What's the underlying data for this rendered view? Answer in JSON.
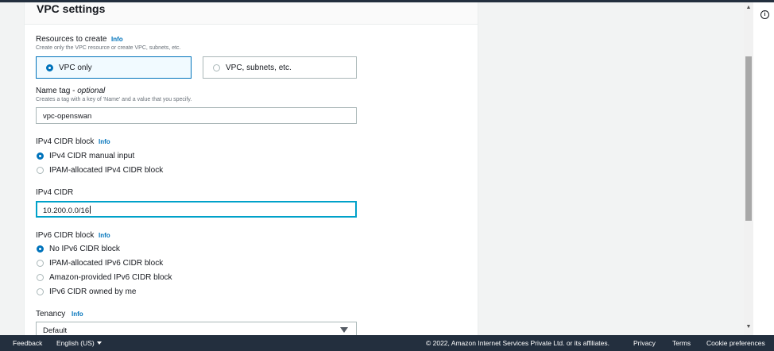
{
  "section": {
    "title": "VPC settings"
  },
  "resources": {
    "label": "Resources to create",
    "info": "Info",
    "description": "Create only the VPC resource or create VPC, subnets, etc.",
    "options": [
      {
        "label": "VPC only",
        "selected": true
      },
      {
        "label": "VPC, subnets, etc.",
        "selected": false
      }
    ]
  },
  "name_tag": {
    "label": "Name tag",
    "optional": "optional",
    "description": "Creates a tag with a key of 'Name' and a value that you specify.",
    "value": "vpc-openswan"
  },
  "ipv4_block": {
    "label": "IPv4 CIDR block",
    "info": "Info",
    "options": [
      {
        "label": "IPv4 CIDR manual input",
        "selected": true
      },
      {
        "label": "IPAM-allocated IPv4 CIDR block",
        "selected": false
      }
    ]
  },
  "ipv4_cidr": {
    "label": "IPv4 CIDR",
    "value": "10.200.0.0/16"
  },
  "ipv6_block": {
    "label": "IPv6 CIDR block",
    "info": "Info",
    "options": [
      {
        "label": "No IPv6 CIDR block",
        "selected": true
      },
      {
        "label": "IPAM-allocated IPv6 CIDR block",
        "selected": false
      },
      {
        "label": "Amazon-provided IPv6 CIDR block",
        "selected": false
      },
      {
        "label": "IPv6 CIDR owned by me",
        "selected": false
      }
    ]
  },
  "tenancy": {
    "label": "Tenancy",
    "info": "Info",
    "value": "Default"
  },
  "footer": {
    "feedback": "Feedback",
    "language": "English (US)",
    "copyright": "© 2022, Amazon Internet Services Private Ltd. or its affiliates.",
    "privacy": "Privacy",
    "terms": "Terms",
    "cookies": "Cookie preferences"
  },
  "colors": {
    "accent": "#0073bb",
    "focus": "#00a1c9",
    "footer_bg": "#232f3e",
    "tile_selected_bg": "#f1faff"
  }
}
